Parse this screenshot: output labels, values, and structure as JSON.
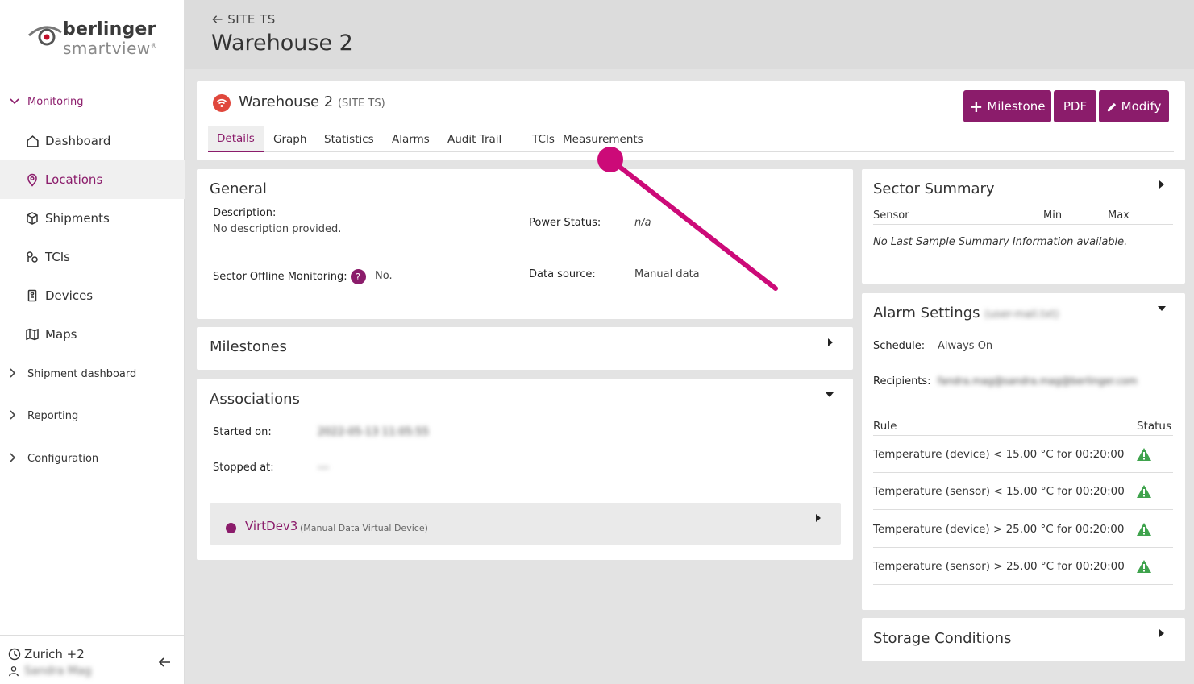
{
  "brand": {
    "line1": "berlinger",
    "line2": "smartview"
  },
  "sidebar": {
    "groups": [
      {
        "label": "Monitoring"
      },
      {
        "label": "Shipment dashboard"
      },
      {
        "label": "Reporting"
      },
      {
        "label": "Configuration"
      }
    ],
    "items": [
      {
        "label": "Dashboard"
      },
      {
        "label": "Locations"
      },
      {
        "label": "Shipments"
      },
      {
        "label": "TCIs"
      },
      {
        "label": "Devices"
      },
      {
        "label": "Maps"
      }
    ],
    "footer": {
      "timezone": "Zurich +2",
      "user": "Sandra Mag"
    }
  },
  "header": {
    "back_label": "SITE TS",
    "title": "Warehouse 2"
  },
  "location": {
    "name": "Warehouse 2",
    "site": "(SITE TS)",
    "buttons": {
      "milestone": "Milestone",
      "pdf": "PDF",
      "modify": "Modify"
    },
    "tabs": [
      "Details",
      "Graph",
      "Statistics",
      "Alarms",
      "Audit Trail",
      "TCIs",
      "Measurements"
    ]
  },
  "general": {
    "title": "General",
    "description_label": "Description:",
    "description_value": "No description provided.",
    "power_label": "Power Status:",
    "power_value": "n/a",
    "offline_label": "Sector Offline Monitoring:",
    "offline_help": "?",
    "offline_value": "No.",
    "source_label": "Data source:",
    "source_value": "Manual data"
  },
  "milestones": {
    "title": "Milestones"
  },
  "associations": {
    "title": "Associations",
    "started_label": "Started on:",
    "started_value": "2022-05-13 11:05:55",
    "stopped_label": "Stopped at:",
    "stopped_value": "---",
    "device_name": "VirtDev3",
    "device_type": "(Manual Data Virtual Device)"
  },
  "sector_summary": {
    "title": "Sector Summary",
    "col_sensor": "Sensor",
    "col_min": "Min",
    "col_max": "Max",
    "empty": "No Last Sample Summary Information available."
  },
  "alarm_settings": {
    "title": "Alarm Settings",
    "title_suffix": "(user-mail.txt)",
    "schedule_label": "Schedule:",
    "schedule_value": "Always On",
    "recipients_label": "Recipients:",
    "recipients_value": "fandra.mag@sandra.mag@berlinger.com",
    "col_rule": "Rule",
    "col_status": "Status",
    "rules": [
      {
        "text": "Temperature (device) < 15.00 °C for 00:20:00"
      },
      {
        "text": "Temperature (sensor) < 15.00 °C for 00:20:00"
      },
      {
        "text": "Temperature (device) > 25.00 °C for 00:20:00"
      },
      {
        "text": "Temperature (sensor) > 25.00 °C for 00:20:00"
      }
    ]
  },
  "storage": {
    "title": "Storage Conditions"
  },
  "colors": {
    "accent": "#8b1c6b",
    "annotation": "#cc0a78",
    "warning": "#3fa34d",
    "wifi": "#e0473c"
  }
}
